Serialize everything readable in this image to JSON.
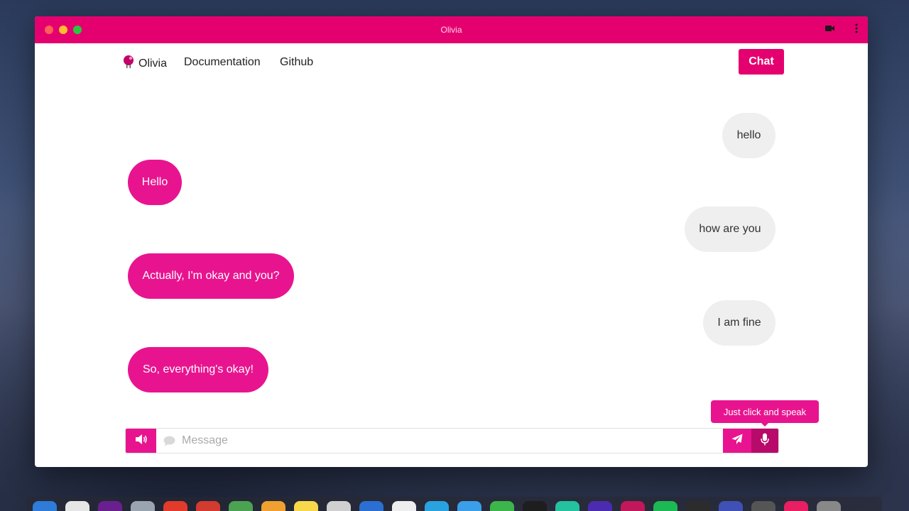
{
  "window": {
    "title": "Olivia"
  },
  "nav": {
    "brand": "Olivia",
    "links": [
      "Documentation",
      "Github"
    ],
    "chat_button": "Chat"
  },
  "messages": [
    {
      "from": "user",
      "text": "hello"
    },
    {
      "from": "bot",
      "text": "Hello"
    },
    {
      "from": "user",
      "text": "how are you"
    },
    {
      "from": "bot",
      "text": "Actually, I'm okay and you?"
    },
    {
      "from": "user",
      "text": "I am fine"
    },
    {
      "from": "bot",
      "text": "So, everything's okay!"
    }
  ],
  "tooltip": "Just click and speak",
  "composer": {
    "placeholder": "Message",
    "value": ""
  },
  "colors": {
    "accent": "#e5006f",
    "bot_bubble": "#e8148f",
    "user_bubble": "#efefef",
    "mic_active": "#b80a6b"
  },
  "icons": {
    "speaker": "volume-icon",
    "message": "comment-icon",
    "send": "paper-plane-icon",
    "mic": "microphone-icon",
    "video": "video-camera-icon",
    "menu": "kebab-menu-icon"
  }
}
